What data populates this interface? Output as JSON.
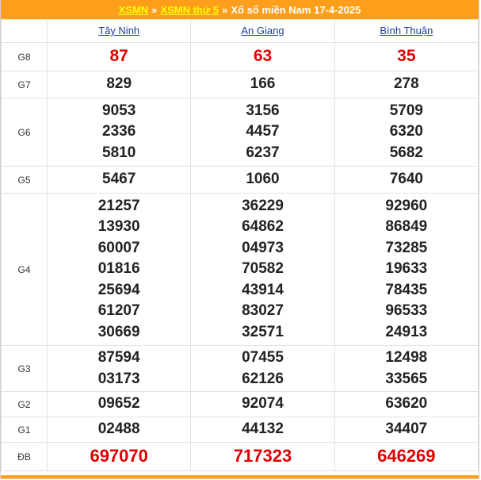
{
  "header": {
    "link1": "XSMN",
    "sep1": "»",
    "link2": "XSMN thứ 5",
    "sep2": "»",
    "title": "Xổ số miền Nam 17-4-2025"
  },
  "provinces": [
    "Tây Ninh",
    "An Giang",
    "Bình Thuận"
  ],
  "prizes": [
    {
      "label": "G8",
      "values": [
        [
          "87"
        ],
        [
          "63"
        ],
        [
          "35"
        ]
      ]
    },
    {
      "label": "G7",
      "values": [
        [
          "829"
        ],
        [
          "166"
        ],
        [
          "278"
        ]
      ]
    },
    {
      "label": "G6",
      "values": [
        [
          "9053",
          "2336",
          "5810"
        ],
        [
          "3156",
          "4457",
          "6237"
        ],
        [
          "5709",
          "6320",
          "5682"
        ]
      ]
    },
    {
      "label": "G5",
      "values": [
        [
          "5467"
        ],
        [
          "1060"
        ],
        [
          "7640"
        ]
      ]
    },
    {
      "label": "G4",
      "values": [
        [
          "21257",
          "13930",
          "60007",
          "01816",
          "25694",
          "61207",
          "30669"
        ],
        [
          "36229",
          "64862",
          "04973",
          "70582",
          "43914",
          "83027",
          "32571"
        ],
        [
          "92960",
          "86849",
          "73285",
          "19633",
          "78435",
          "96533",
          "24913"
        ]
      ]
    },
    {
      "label": "G3",
      "values": [
        [
          "87594",
          "03173"
        ],
        [
          "07455",
          "62126"
        ],
        [
          "12498",
          "33565"
        ]
      ]
    },
    {
      "label": "G2",
      "values": [
        [
          "09652"
        ],
        [
          "92074"
        ],
        [
          "63620"
        ]
      ]
    },
    {
      "label": "G1",
      "values": [
        [
          "02488"
        ],
        [
          "44132"
        ],
        [
          "34407"
        ]
      ]
    },
    {
      "label": "ĐB",
      "values": [
        [
          "697070"
        ],
        [
          "717323"
        ],
        [
          "646269"
        ]
      ]
    }
  ],
  "colors": {
    "header_bg": "#ff9e1b",
    "header_link": "#ffff00",
    "highlight": "#e00000",
    "province": "#1a3a9c"
  }
}
